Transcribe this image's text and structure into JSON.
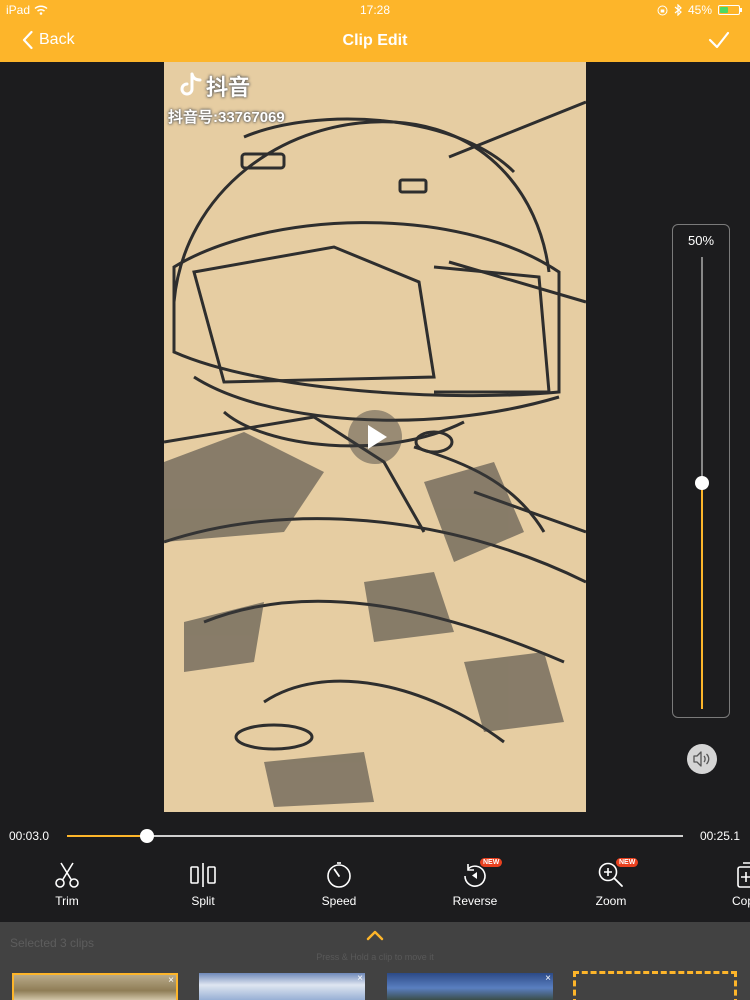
{
  "status_bar": {
    "carrier": "iPad",
    "time": "17:28",
    "battery": "45%",
    "battery_level": 0.45
  },
  "nav": {
    "back_label": "Back",
    "title": "Clip Edit"
  },
  "preview": {
    "watermark_brand": "抖音",
    "watermark_account": "抖音号:33767069"
  },
  "volume": {
    "label": "50%",
    "level": 0.5
  },
  "playback": {
    "current_time": "00:03.0",
    "total_time": "00:25.1",
    "progress": 0.13
  },
  "tools": [
    {
      "label": "Trim",
      "icon": "scissors-icon"
    },
    {
      "label": "Split",
      "icon": "split-icon"
    },
    {
      "label": "Speed",
      "icon": "speed-icon"
    },
    {
      "label": "Reverse",
      "icon": "reverse-icon",
      "badge": "NEW"
    },
    {
      "label": "Zoom",
      "icon": "zoom-icon",
      "badge": "NEW"
    },
    {
      "label": "Cop",
      "icon": "copy-icon"
    }
  ],
  "bottom": {
    "selected_label": "Selected 3 clips",
    "hint": "Press & Hold a clip to move it",
    "clip_remove": "×"
  },
  "colors": {
    "accent": "#fdb52a",
    "background": "#1c1c1e",
    "panel": "#424242",
    "badge": "#e9411f"
  }
}
